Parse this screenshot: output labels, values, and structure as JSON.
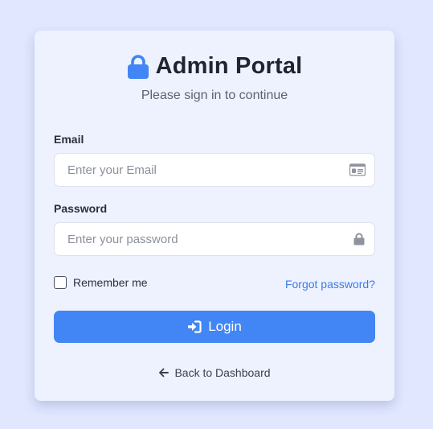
{
  "header": {
    "title": "Admin Portal",
    "subtitle": "Please sign in to continue",
    "icon": "lock-icon"
  },
  "form": {
    "email": {
      "label": "Email",
      "placeholder": "Enter your Email",
      "value": "",
      "icon": "id-card-icon"
    },
    "password": {
      "label": "Password",
      "placeholder": "Enter your password",
      "value": "",
      "icon": "lock-icon"
    },
    "remember_label": "Remember me",
    "remember_checked": false,
    "forgot_label": "Forgot password?",
    "login_label": "Login",
    "login_icon": "sign-in-icon"
  },
  "footer": {
    "back_label": "Back to Dashboard",
    "back_icon": "arrow-left-icon"
  },
  "colors": {
    "page_background": "#e0e7ff",
    "card_background": "#eef2ff",
    "accent": "#4285f4",
    "link": "#3b7be8",
    "title_text": "#1f2430"
  }
}
